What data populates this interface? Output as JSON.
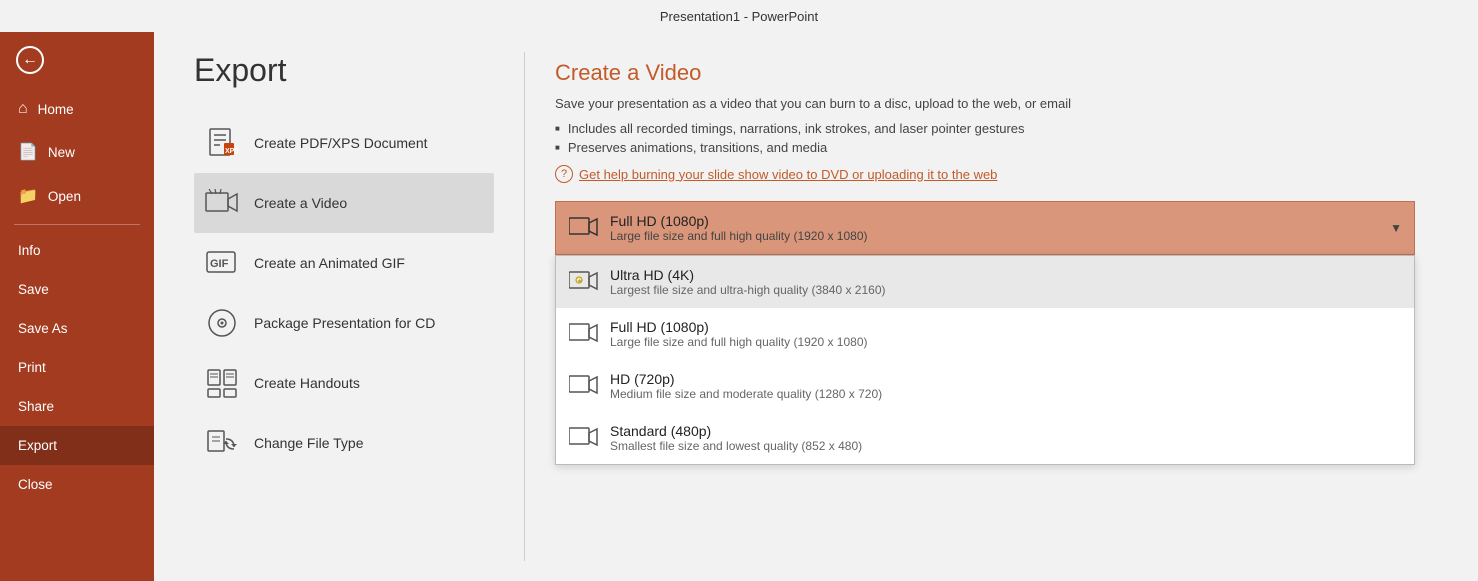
{
  "titleBar": {
    "text": "Presentation1  -  PowerPoint"
  },
  "sidebar": {
    "backLabel": "←",
    "items": [
      {
        "id": "home",
        "label": "Home",
        "icon": "🏠",
        "active": false
      },
      {
        "id": "new",
        "label": "New",
        "icon": "📄",
        "active": false
      },
      {
        "id": "open",
        "label": "Open",
        "icon": "📂",
        "active": false
      },
      {
        "id": "info",
        "label": "Info",
        "icon": "",
        "active": false
      },
      {
        "id": "save",
        "label": "Save",
        "icon": "",
        "active": false
      },
      {
        "id": "save-as",
        "label": "Save As",
        "icon": "",
        "active": false
      },
      {
        "id": "print",
        "label": "Print",
        "icon": "",
        "active": false
      },
      {
        "id": "share",
        "label": "Share",
        "icon": "",
        "active": false
      },
      {
        "id": "export",
        "label": "Export",
        "icon": "",
        "active": true
      },
      {
        "id": "close",
        "label": "Close",
        "icon": "",
        "active": false
      }
    ]
  },
  "exportMenu": {
    "title": "Export",
    "options": [
      {
        "id": "pdf",
        "label": "Create PDF/XPS Document",
        "selected": false
      },
      {
        "id": "video",
        "label": "Create a Video",
        "selected": true
      },
      {
        "id": "gif",
        "label": "Create an Animated GIF",
        "selected": false
      },
      {
        "id": "package",
        "label": "Package Presentation for CD",
        "selected": false
      },
      {
        "id": "handouts",
        "label": "Create Handouts",
        "selected": false
      },
      {
        "id": "changetype",
        "label": "Change File Type",
        "selected": false
      }
    ]
  },
  "detailPanel": {
    "title": "Create a Video",
    "description": "Save your presentation as a video that you can burn to a disc, upload to the web, or email",
    "bullets": [
      "Includes all recorded timings, narrations, ink strokes, and laser pointer gestures",
      "Preserves animations, transitions, and media"
    ],
    "helpLink": "Get help burning your slide show video to DVD or uploading it to the web"
  },
  "dropdown": {
    "selectedTitle": "Full HD (1080p)",
    "selectedSubtitle": "Large file size and full high quality (1920 x 1080)",
    "options": [
      {
        "id": "ultra-hd",
        "title": "Ultra HD (4K)",
        "subtitle": "Largest file size and ultra-high quality (3840 x 2160)",
        "highlighted": true
      },
      {
        "id": "full-hd",
        "title": "Full HD (1080p)",
        "subtitle": "Large file size and full high quality (1920 x 1080)",
        "highlighted": false
      },
      {
        "id": "hd",
        "title": "HD (720p)",
        "subtitle": "Medium file size and moderate quality (1280 x 720)",
        "highlighted": false
      },
      {
        "id": "standard",
        "title": "Standard (480p)",
        "subtitle": "Smallest file size and lowest quality (852 x 480)",
        "highlighted": false
      }
    ]
  }
}
